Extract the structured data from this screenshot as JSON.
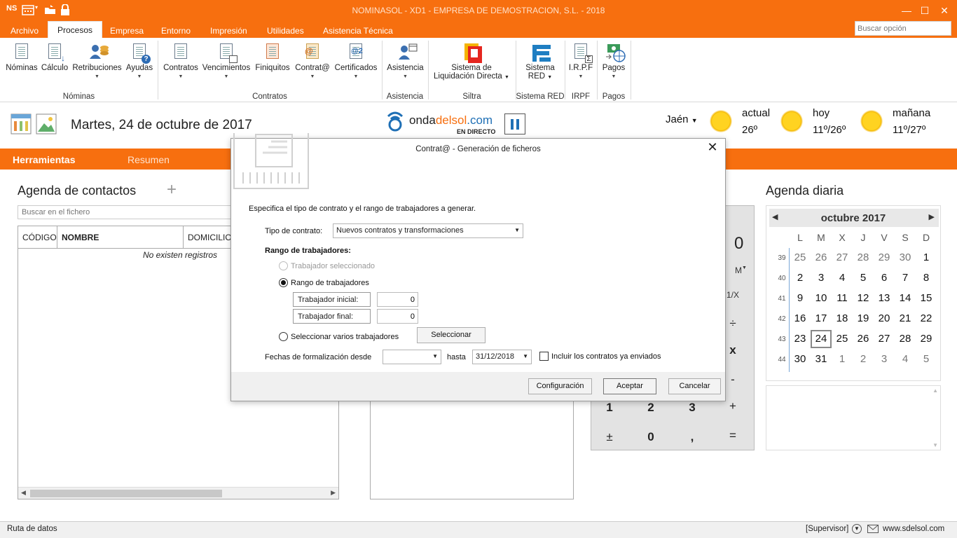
{
  "window": {
    "title": "NOMINASOL - XD1 - EMPRESA DE DEMOSTRACION, S.L. - 2018",
    "app_badge": "NS",
    "minimize": "—",
    "maximize": "☐",
    "close": "✕"
  },
  "menu": {
    "tabs": [
      "Archivo",
      "Procesos",
      "Empresa",
      "Entorno",
      "Impresión",
      "Utilidades",
      "Asistencia Técnica"
    ],
    "active": "Procesos",
    "search_placeholder": "Buscar opción"
  },
  "ribbon": {
    "buttons": {
      "nominas": "Nóminas",
      "calculo": "Cálculo",
      "retribuciones": "Retribuciones",
      "ayudas": "Ayudas",
      "contratos": "Contratos",
      "vencimientos": "Vencimientos",
      "finiquitos": "Finiquitos",
      "contrata": "Contrat@",
      "certificados": "Certificados",
      "asistencia": "Asistencia",
      "siltra_line1": "Sistema de",
      "siltra_line2": "Liquidación Directa",
      "red_line1": "Sistema",
      "red_line2": "RED",
      "irpf": "I.R.P.F",
      "pagos": "Pagos"
    },
    "groups": {
      "nominas": "Nóminas",
      "contratos": "Contratos",
      "asistencia": "Asistencia",
      "siltra": "Siltra",
      "red": "Sistema RED",
      "irpf": "IRPF",
      "pagos": "Pagos"
    }
  },
  "header": {
    "date": "Martes, 24 de octubre de 2017",
    "radio_brand_a": "onda",
    "radio_brand_b": "delsol",
    "radio_brand_c": ".com",
    "radio_sub": "EN DIRECTO",
    "city": "Jaén",
    "weather": [
      {
        "label": "actual",
        "temp": "26º"
      },
      {
        "label": "hoy",
        "temp": "11º/26º"
      },
      {
        "label": "mañana",
        "temp": "11º/27º"
      }
    ]
  },
  "tabs_bar": {
    "herramientas": "Herramientas",
    "resumen": "Resumen"
  },
  "contacts": {
    "title": "Agenda de contactos",
    "add": "+",
    "search_placeholder": "Buscar en el fichero",
    "columns": [
      "CÓDIGO",
      "NOMBRE",
      "DOMICILIO"
    ],
    "empty": "No existen registros"
  },
  "calculator": {
    "display": "0",
    "m": "M",
    "inv": "1/X",
    "keys": [
      "÷",
      "x",
      "-",
      "1",
      "2",
      "3",
      "+",
      "±",
      "0",
      ",",
      "="
    ]
  },
  "agenda": {
    "title": "Agenda diaria",
    "month": "octubre 2017",
    "prev": "◀",
    "next": "▶",
    "dow": [
      "L",
      "M",
      "X",
      "J",
      "V",
      "S",
      "D"
    ],
    "weeks": [
      {
        "n": "39",
        "days": [
          "25",
          "26",
          "27",
          "28",
          "29",
          "30",
          "1"
        ]
      },
      {
        "n": "40",
        "days": [
          "2",
          "3",
          "4",
          "5",
          "6",
          "7",
          "8"
        ]
      },
      {
        "n": "41",
        "days": [
          "9",
          "10",
          "11",
          "12",
          "13",
          "14",
          "15"
        ]
      },
      {
        "n": "42",
        "days": [
          "16",
          "17",
          "18",
          "19",
          "20",
          "21",
          "22"
        ]
      },
      {
        "n": "43",
        "days": [
          "23",
          "24",
          "25",
          "26",
          "27",
          "28",
          "29"
        ]
      },
      {
        "n": "44",
        "days": [
          "30",
          "31",
          "1",
          "2",
          "3",
          "4",
          "5"
        ]
      }
    ],
    "today": "24"
  },
  "dialog": {
    "title": "Contrat@ - Generación de ficheros",
    "close": "✕",
    "intro": "Especifica el tipo de contrato y el rango de trabajadores a generar.",
    "tipo_label": "Tipo de contrato:",
    "tipo_value": "Nuevos contratos y transformaciones",
    "rango_heading": "Rango de trabajadores:",
    "opt_seleccionado": "Trabajador seleccionado",
    "opt_rango": "Rango de trabajadores",
    "inicial_label": "Trabajador inicial:",
    "inicial_value": "0",
    "final_label": "Trabajador final:",
    "final_value": "0",
    "opt_varios": "Seleccionar varios trabajadores",
    "seleccionar": "Seleccionar",
    "fechas_label": "Fechas de formalización desde",
    "desde_value": "",
    "hasta_label": "hasta",
    "hasta_value": "31/12/2018",
    "incluir_label": "Incluir los contratos ya enviados",
    "btn_config": "Configuración",
    "btn_aceptar": "Aceptar",
    "btn_cancelar": "Cancelar"
  },
  "status": {
    "left": "Ruta de datos",
    "user": "[Supervisor]",
    "site": "www.sdelsol.com"
  },
  "colors": {
    "accent": "#f76f0f",
    "title_text": "#ffe2cc"
  }
}
